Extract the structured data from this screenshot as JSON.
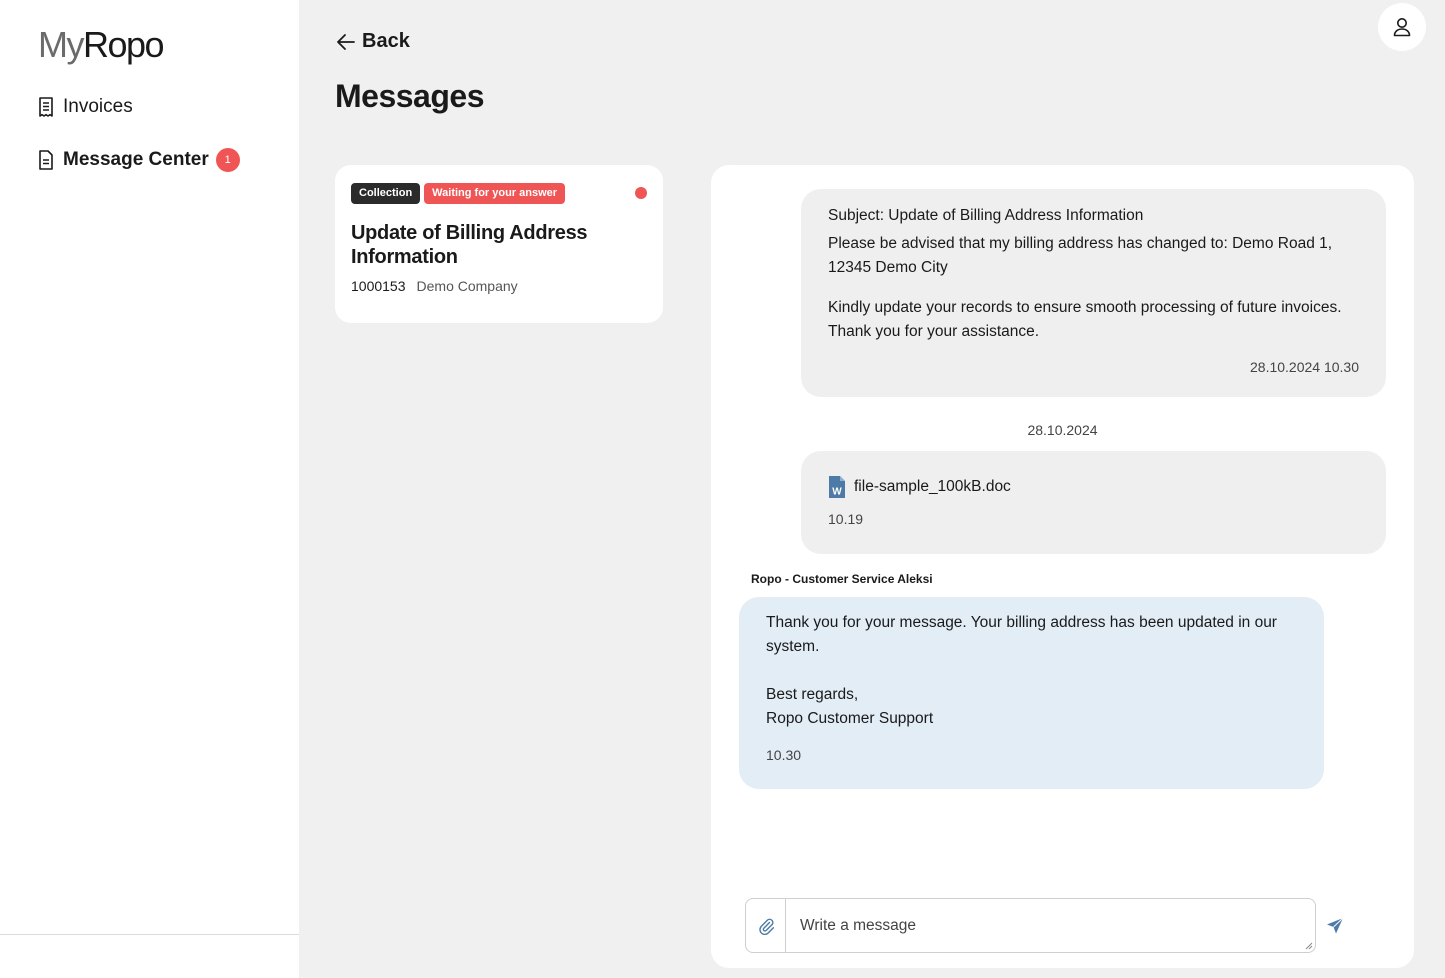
{
  "app": {
    "logo_my": "My",
    "logo_ropo": "Ropo"
  },
  "sidebar": {
    "items": [
      {
        "label": "Invoices",
        "icon": "receipt-icon"
      },
      {
        "label": "Message Center",
        "icon": "document-icon",
        "badge": "1"
      }
    ]
  },
  "header": {
    "back_label": "Back",
    "title": "Messages"
  },
  "thread": {
    "tags": [
      "Collection",
      "Waiting for your answer"
    ],
    "title": "Update of Billing Address Information",
    "number": "1000153",
    "company": "Demo Company",
    "unread": true
  },
  "conversation": {
    "messages": [
      {
        "subject": "Subject: Update of Billing Address Information",
        "para1": "Please be advised that my billing address has changed to: Demo Road 1, 12345 Demo City",
        "para2": "Kindly update your records to ensure smooth processing of future invoices. Thank you for your assistance.",
        "time": "28.10.2024 10.30"
      },
      {
        "date_separator": "28.10.2024",
        "attachment": "file-sample_100kB.doc",
        "time": "10.19"
      },
      {
        "sender": "Ropo - Customer Service Aleksi",
        "body": "Thank you for your message. Your billing address has been updated in our system.\n\nBest regards,\nRopo Customer Support",
        "time": "10.30"
      }
    ]
  },
  "composer": {
    "placeholder": "Write a message"
  },
  "colors": {
    "accent_red": "#f05555",
    "incoming_bubble": "#e3edf6",
    "outgoing_bubble": "#efefef",
    "send_icon": "#4d7aa6"
  }
}
